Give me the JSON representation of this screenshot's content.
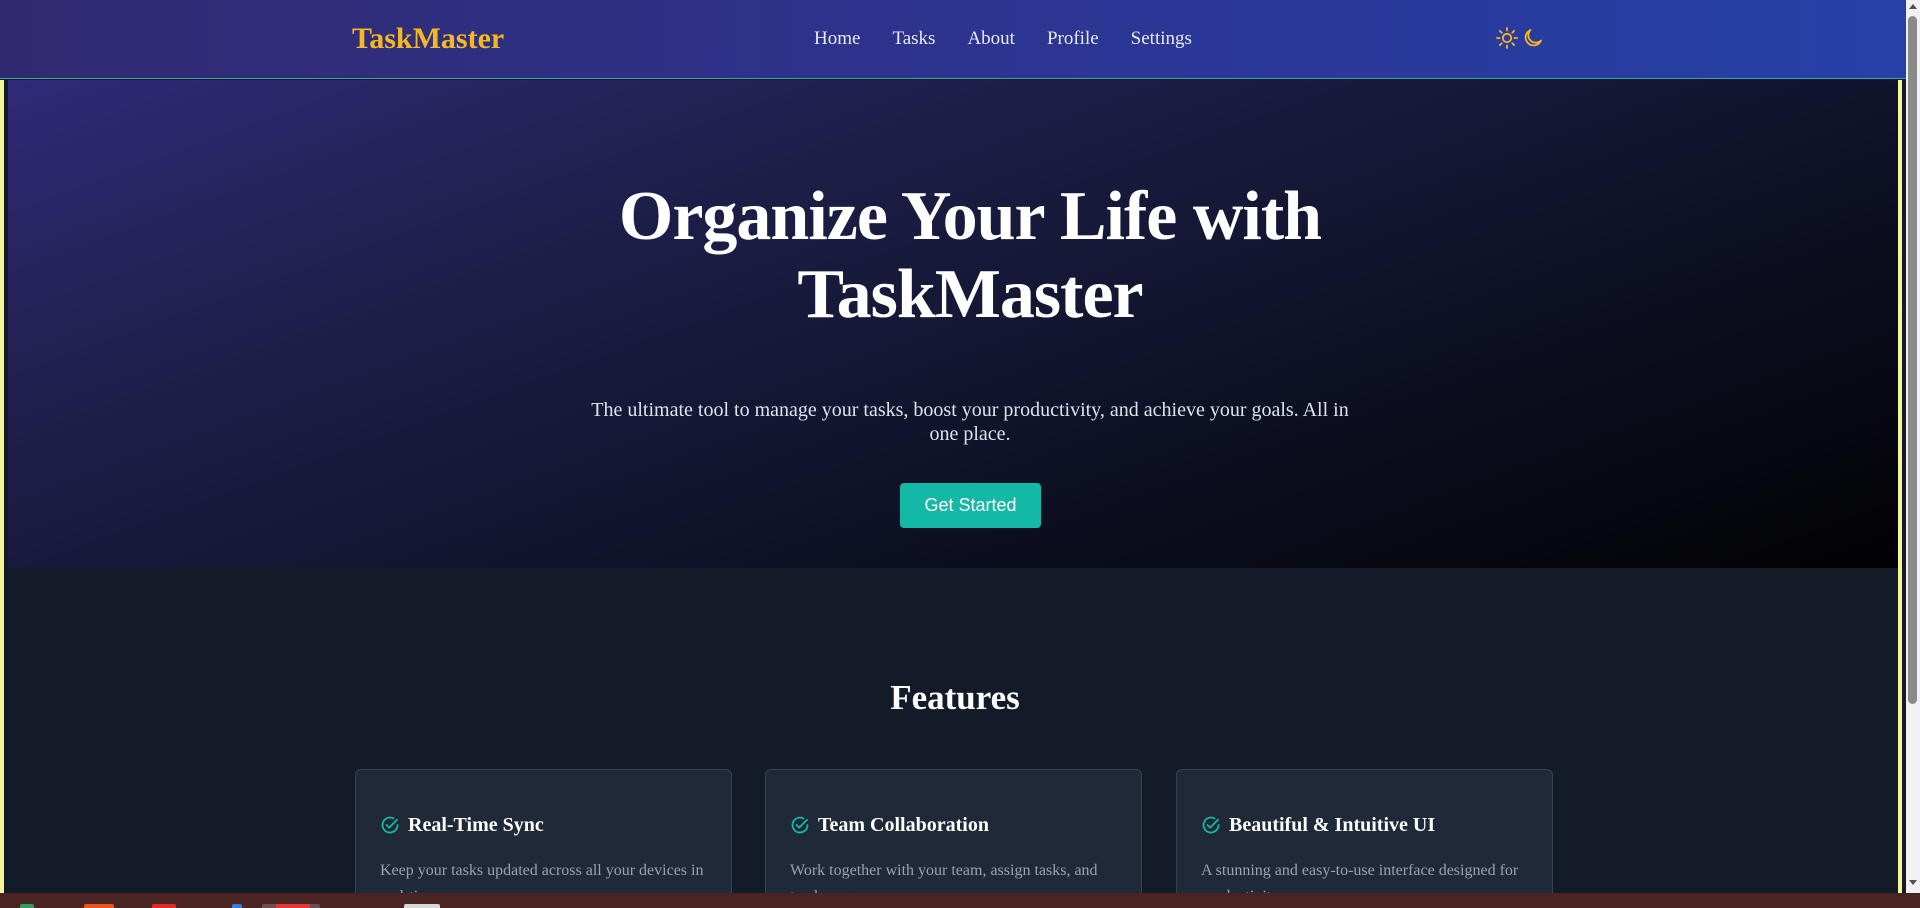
{
  "navbar": {
    "brand": "TaskMaster",
    "links": [
      "Home",
      "Tasks",
      "About",
      "Profile",
      "Settings"
    ],
    "theme_icons": [
      "sun-icon",
      "moon-icon"
    ]
  },
  "hero": {
    "title_line1": "Organize Your Life with",
    "title_line2": "TaskMaster",
    "subtitle": "The ultimate tool to manage your tasks, boost your productivity, and achieve your goals. All in one place.",
    "cta": "Get Started"
  },
  "features": {
    "heading": "Features",
    "cards": [
      {
        "title": "Real-Time Sync",
        "description": "Keep your tasks updated across all your devices in real-time.",
        "icon": "check-circle-icon"
      },
      {
        "title": "Team Collaboration",
        "description": "Work together with your team, assign tasks, and track progress.",
        "icon": "check-circle-icon"
      },
      {
        "title": "Beautiful & Intuitive UI",
        "description": "A stunning and easy-to-use interface designed for productivity.",
        "icon": "check-circle-icon"
      }
    ]
  },
  "colors": {
    "brand": "#f5b820",
    "accent": "#14b8a6",
    "background": "#131a28",
    "card": "#1f2938"
  }
}
